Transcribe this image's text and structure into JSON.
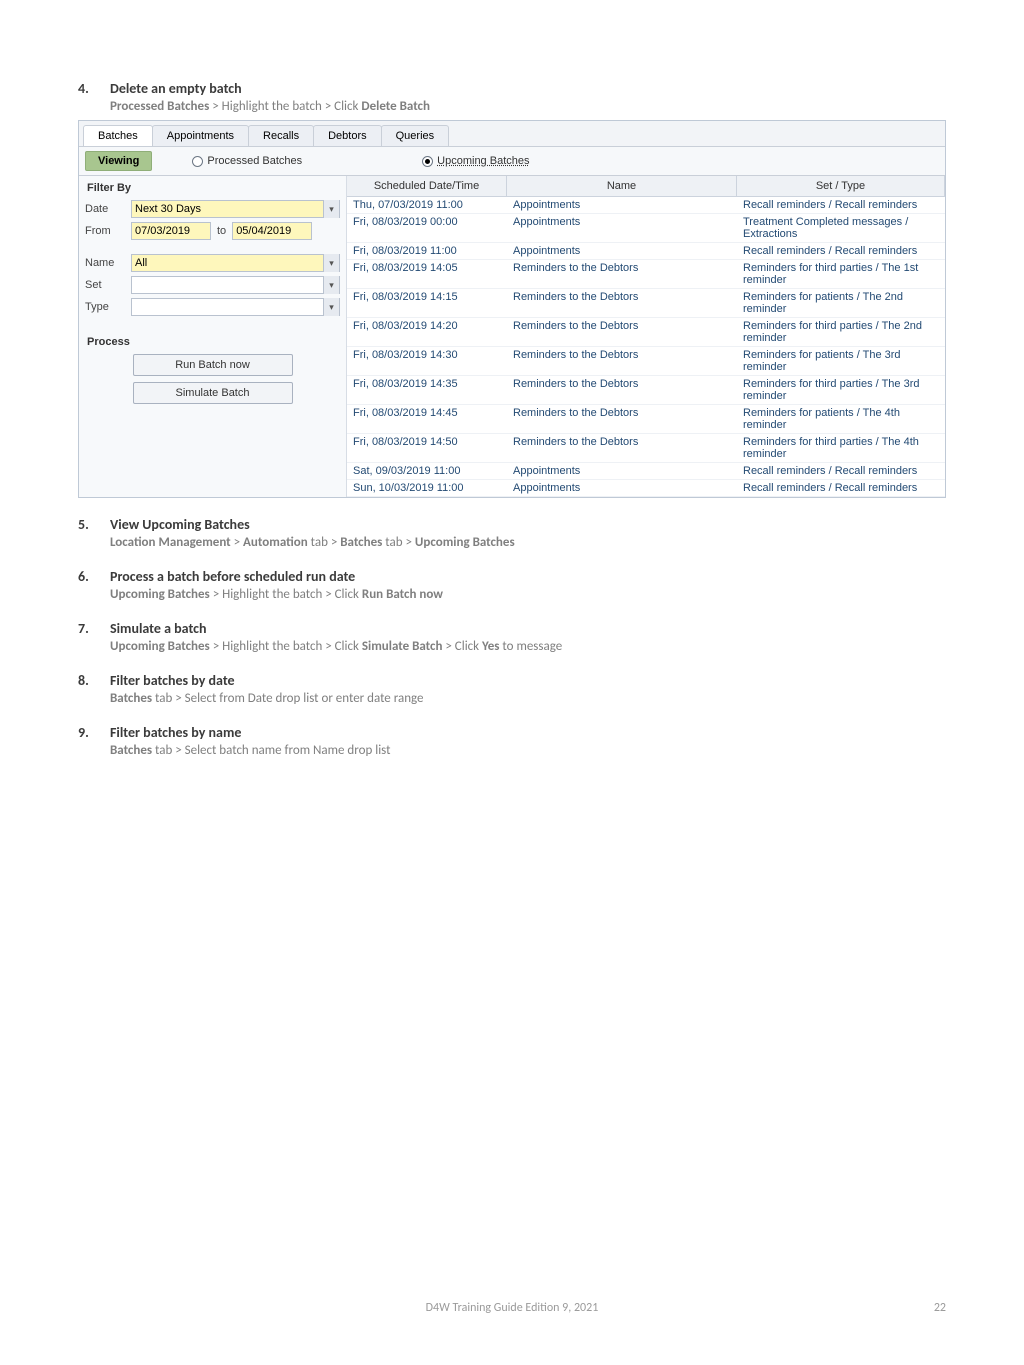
{
  "steps": [
    {
      "title": "Delete an empty batch",
      "body_parts": [
        "Processed Batches",
        " > Highlight the batch > Click ",
        "Delete Batch"
      ]
    },
    {
      "title": "View Upcoming Batches",
      "body_parts": [
        "Location Management",
        " > ",
        "Automation",
        " tab > ",
        "Batches",
        " tab > ",
        "Upcoming Batches"
      ]
    },
    {
      "title": "Process a batch before scheduled run date",
      "body_parts": [
        "Upcoming Batches",
        " > Highlight the batch > Click ",
        "Run Batch now"
      ]
    },
    {
      "title": "Simulate a batch",
      "body_parts": [
        "Upcoming Batches",
        " > Highlight the batch > Click ",
        "Simulate Batch",
        " > Click ",
        "Yes",
        " to message"
      ]
    },
    {
      "title": "Filter batches by date",
      "body_parts": [
        "Batches",
        " tab > Select from Date drop list or enter date range"
      ]
    },
    {
      "title": "Filter batches by name",
      "body_parts": [
        "Batches",
        " tab > Select batch name from Name drop list"
      ]
    }
  ],
  "app": {
    "tabs": [
      "Batches",
      "Appointments",
      "Recalls",
      "Debtors",
      "Queries"
    ],
    "viewing_label": "Viewing",
    "radio_processed": "Processed Batches",
    "radio_upcoming": "Upcoming Batches",
    "filter_by": "Filter By",
    "form": {
      "date_lbl": "Date",
      "date_val": "Next 30 Days",
      "from_lbl": "From",
      "from_val": "07/03/2019",
      "to_lbl": "to",
      "to_val": "05/04/2019",
      "name_lbl": "Name",
      "name_val": "All",
      "set_lbl": "Set",
      "type_lbl": "Type"
    },
    "process_head": "Process",
    "btn_run": "Run Batch now",
    "btn_sim": "Simulate Batch",
    "columns": [
      "Scheduled Date/Time",
      "Name",
      "Set / Type"
    ],
    "rows": [
      [
        "Thu, 07/03/2019 11:00",
        "Appointments",
        "Recall reminders / Recall reminders"
      ],
      [
        "Fri, 08/03/2019 00:00",
        "Appointments",
        "Treatment Completed messages / Extractions"
      ],
      [
        "Fri, 08/03/2019 11:00",
        "Appointments",
        "Recall reminders / Recall reminders"
      ],
      [
        "Fri, 08/03/2019 14:05",
        "Reminders to the Debtors",
        "Reminders for third parties / The 1st reminder"
      ],
      [
        "Fri, 08/03/2019 14:15",
        "Reminders to the Debtors",
        "Reminders for patients / The 2nd reminder"
      ],
      [
        "Fri, 08/03/2019 14:20",
        "Reminders to the Debtors",
        "Reminders for third parties / The 2nd reminder"
      ],
      [
        "Fri, 08/03/2019 14:30",
        "Reminders to the Debtors",
        "Reminders for patients / The 3rd reminder"
      ],
      [
        "Fri, 08/03/2019 14:35",
        "Reminders to the Debtors",
        "Reminders for third parties / The 3rd reminder"
      ],
      [
        "Fri, 08/03/2019 14:45",
        "Reminders to the Debtors",
        "Reminders for patients / The 4th reminder"
      ],
      [
        "Fri, 08/03/2019 14:50",
        "Reminders to the Debtors",
        "Reminders for third parties / The 4th reminder"
      ],
      [
        "Sat, 09/03/2019 11:00",
        "Appointments",
        "Recall reminders / Recall reminders"
      ],
      [
        "Sun, 10/03/2019 11:00",
        "Appointments",
        "Recall reminders / Recall reminders"
      ]
    ]
  },
  "footer": "D4W Training Guide Edition 9, 2021",
  "pagenum": "22"
}
